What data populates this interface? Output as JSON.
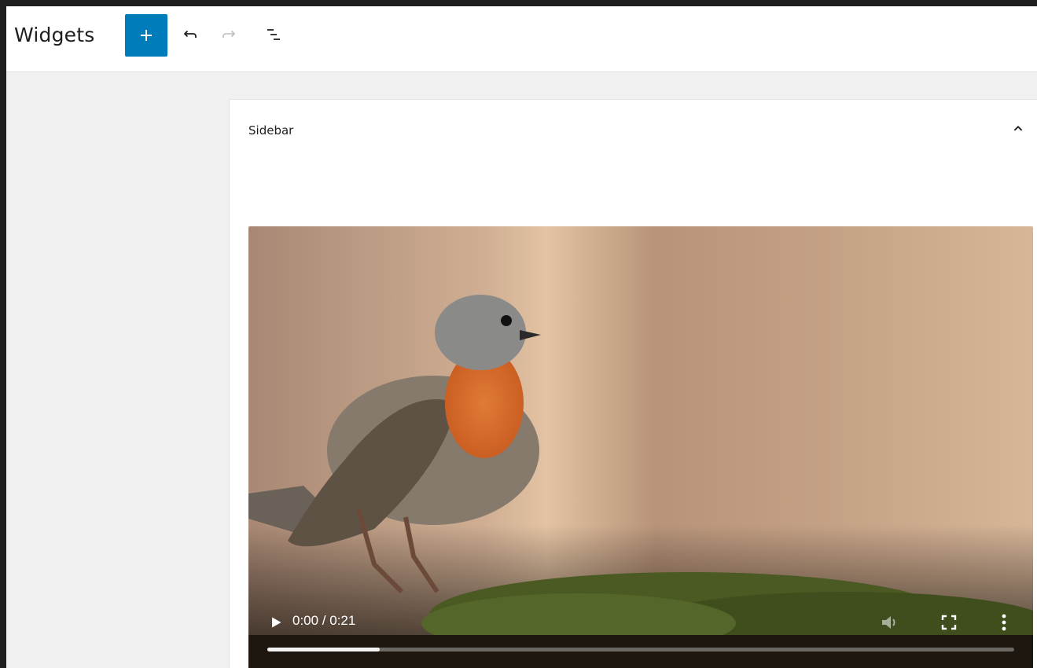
{
  "app": {
    "title": "Widgets"
  },
  "toolbar": {
    "add_icon": "plus-icon",
    "undo_icon": "undo-icon",
    "redo_icon": "redo-icon",
    "outline_icon": "list-view-icon",
    "accent_color": "#007cba"
  },
  "panel": {
    "title": "Sidebar",
    "toggle_icon": "chevron-up-icon"
  },
  "video": {
    "time_display": "0:00 / 0:21",
    "progress_buffered_fraction": 0.15,
    "controls": [
      "play-icon",
      "volume-icon",
      "fullscreen-icon",
      "more-options-icon"
    ]
  }
}
